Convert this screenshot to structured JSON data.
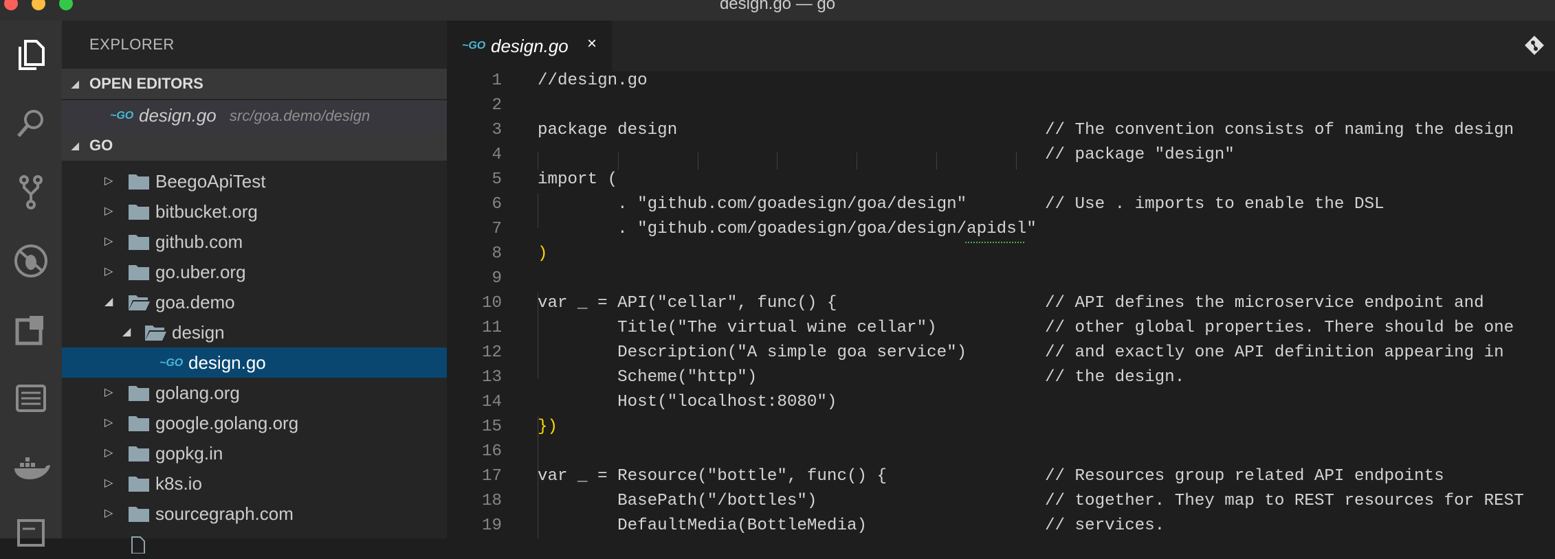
{
  "window": {
    "title": "design.go — go"
  },
  "sidebar": {
    "heading": "EXPLORER",
    "open_editors_label": "OPEN EDITORS",
    "open_file": {
      "name": "design.go",
      "path": "src/goa.demo/design"
    },
    "workspace_label": "GO",
    "tree": [
      {
        "name": "BeegoApiTest"
      },
      {
        "name": "bitbucket.org"
      },
      {
        "name": "github.com"
      },
      {
        "name": "go.uber.org"
      },
      {
        "name": "goa.demo"
      },
      {
        "name": "design"
      },
      {
        "name": "design.go"
      },
      {
        "name": "golang.org"
      },
      {
        "name": "google.golang.org"
      },
      {
        "name": "gopkg.in"
      },
      {
        "name": "k8s.io"
      },
      {
        "name": "sourcegraph.com"
      }
    ]
  },
  "editor": {
    "tab": {
      "name": "design.go",
      "close": "×"
    },
    "lines": [
      {
        "n": "1",
        "code": "//design.go",
        "comment": ""
      },
      {
        "n": "2",
        "code": "",
        "comment": ""
      },
      {
        "n": "3",
        "code": "package design",
        "comment": "// The convention consists of naming the design"
      },
      {
        "n": "4",
        "code": "",
        "comment": "// package \"design\""
      },
      {
        "n": "5",
        "code": "import (",
        "comment": ""
      },
      {
        "n": "6",
        "code": "        . \"github.com/goadesign/goa/design\"",
        "comment": "// Use . imports to enable the DSL"
      },
      {
        "n": "7",
        "code": "        . \"github.com/goadesign/goa/design/apidsl\"",
        "comment": ""
      },
      {
        "n": "8",
        "code": ")",
        "comment": ""
      },
      {
        "n": "9",
        "code": "",
        "comment": ""
      },
      {
        "n": "10",
        "code": "var _ = API(\"cellar\", func() {",
        "comment": "// API defines the microservice endpoint and"
      },
      {
        "n": "11",
        "code": "        Title(\"The virtual wine cellar\")",
        "comment": "// other global properties. There should be one"
      },
      {
        "n": "12",
        "code": "        Description(\"A simple goa service\")",
        "comment": "// and exactly one API definition appearing in"
      },
      {
        "n": "13",
        "code": "        Scheme(\"http\")",
        "comment": "// the design."
      },
      {
        "n": "14",
        "code": "        Host(\"localhost:8080\")",
        "comment": ""
      },
      {
        "n": "15",
        "code": "})",
        "comment": ""
      },
      {
        "n": "16",
        "code": "",
        "comment": ""
      },
      {
        "n": "17",
        "code": "var _ = Resource(\"bottle\", func() {",
        "comment": "// Resources group related API endpoints"
      },
      {
        "n": "18",
        "code": "        BasePath(\"/bottles\")",
        "comment": "// together. They map to REST resources for REST"
      },
      {
        "n": "19",
        "code": "        DefaultMedia(BottleMedia)",
        "comment": "// services."
      }
    ]
  },
  "icons": {
    "activity": [
      "files-icon",
      "search-icon",
      "source-control-icon",
      "debug-icon",
      "extensions-icon",
      "outline-icon",
      "docker-icon"
    ],
    "colors": {
      "selection": "#094771",
      "go_icon": "#4ab8d8",
      "paren_yellow": "#ffd700",
      "paren_pink": "#e3276f"
    }
  }
}
